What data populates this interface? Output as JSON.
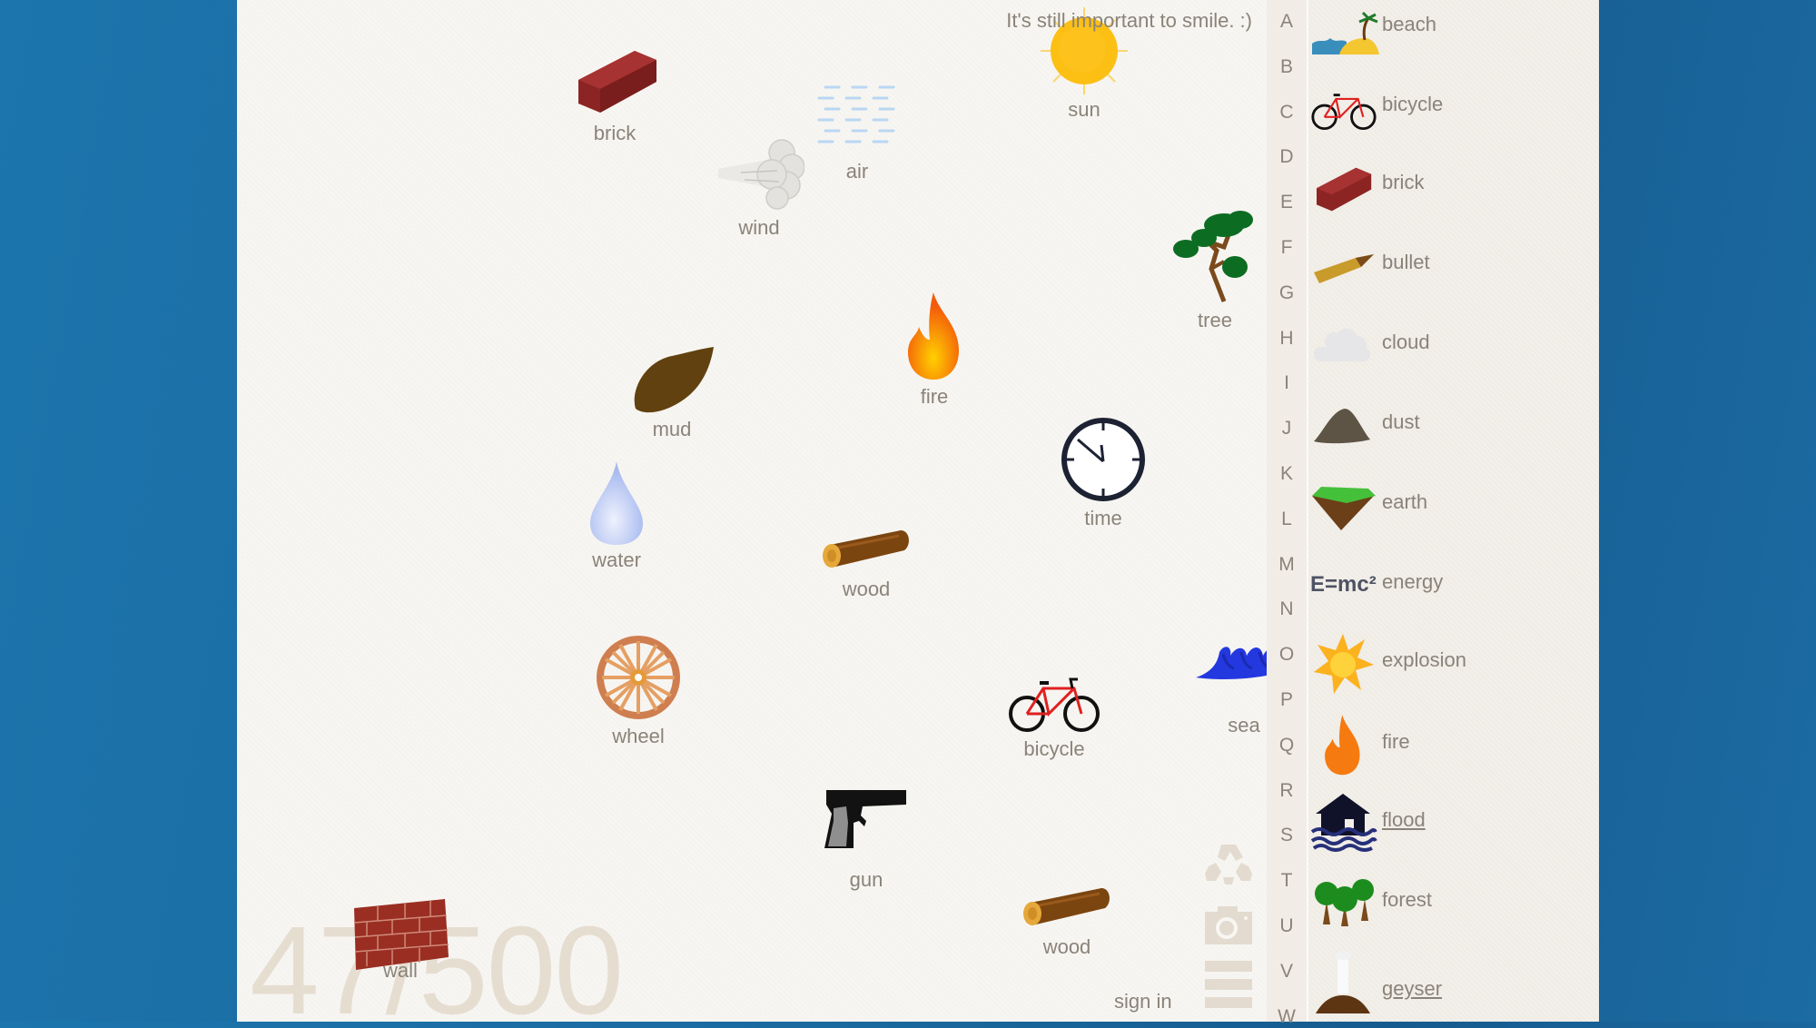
{
  "game": {
    "motto": "It's still important to smile. :)",
    "progress": {
      "discovered": 47,
      "total": 500,
      "display": "47/500"
    },
    "sign_in_label": "sign in"
  },
  "canvas_items": [
    {
      "name": "brick",
      "icon": "brick-icon"
    },
    {
      "name": "wind",
      "icon": "wind-icon"
    },
    {
      "name": "air",
      "icon": "air-icon"
    },
    {
      "name": "sun",
      "icon": "sun-icon"
    },
    {
      "name": "tree",
      "icon": "tree-icon"
    },
    {
      "name": "fire",
      "icon": "fire-icon"
    },
    {
      "name": "mud",
      "icon": "mud-icon"
    },
    {
      "name": "time",
      "icon": "clock-icon"
    },
    {
      "name": "water",
      "icon": "water-drop-icon"
    },
    {
      "name": "wood",
      "icon": "log-icon"
    },
    {
      "name": "wheel",
      "icon": "wheel-icon"
    },
    {
      "name": "bicycle",
      "icon": "bicycle-icon"
    },
    {
      "name": "sea",
      "icon": "wave-icon"
    },
    {
      "name": "gun",
      "icon": "pistol-icon"
    },
    {
      "name": "wood",
      "icon": "log-icon"
    },
    {
      "name": "wall",
      "icon": "brick-wall-icon"
    }
  ],
  "tools": [
    {
      "name": "recycle",
      "icon": "recycle-icon"
    },
    {
      "name": "screenshot",
      "icon": "camera-icon"
    },
    {
      "name": "menu",
      "icon": "hamburger-menu-icon"
    }
  ],
  "alphabet": [
    "A",
    "B",
    "C",
    "D",
    "E",
    "F",
    "G",
    "H",
    "I",
    "J",
    "K",
    "L",
    "M",
    "N",
    "O",
    "P",
    "Q",
    "R",
    "S",
    "T",
    "U",
    "V",
    "W"
  ],
  "library": [
    {
      "name": "beach",
      "icon": "beach-icon",
      "underlined": false
    },
    {
      "name": "bicycle",
      "icon": "bicycle-icon",
      "underlined": false
    },
    {
      "name": "brick",
      "icon": "brick-icon",
      "underlined": false
    },
    {
      "name": "bullet",
      "icon": "bullet-icon",
      "underlined": false
    },
    {
      "name": "cloud",
      "icon": "cloud-icon",
      "underlined": false
    },
    {
      "name": "dust",
      "icon": "dust-pile-icon",
      "underlined": false
    },
    {
      "name": "earth",
      "icon": "earth-icon",
      "underlined": false
    },
    {
      "name": "energy",
      "icon": "emc2-icon",
      "icon_text": "E=mc²",
      "underlined": false
    },
    {
      "name": "explosion",
      "icon": "explosion-icon",
      "underlined": false
    },
    {
      "name": "fire",
      "icon": "fire-icon",
      "underlined": false
    },
    {
      "name": "flood",
      "icon": "flood-icon",
      "underlined": true
    },
    {
      "name": "forest",
      "icon": "forest-icon",
      "underlined": false
    },
    {
      "name": "geyser",
      "icon": "geyser-icon",
      "underlined": true
    }
  ],
  "colors": {
    "background_blue": "#1a6aa0",
    "paper": "#f8f6f2",
    "sidebar": "#f3efe9",
    "text": "#8a8379",
    "counter": "#e6ddd1",
    "tool_icons": "#e3dbcf"
  }
}
